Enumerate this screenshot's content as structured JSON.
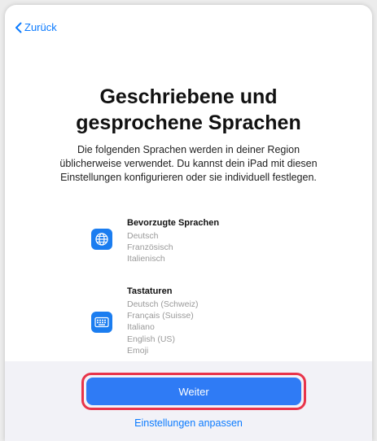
{
  "nav": {
    "back_label": "Zurück"
  },
  "title": {
    "line1": "Geschriebene und",
    "line2": "gesprochene Sprachen"
  },
  "description": {
    "line1": "Die folgenden Sprachen werden in deiner Region",
    "line2": "üblicherweise verwendet. Du kannst dein iPad mit diesen",
    "line3": "Einstellungen konfigurieren oder sie individuell festlegen."
  },
  "preferred_languages": {
    "heading": "Bevorzugte Sprachen",
    "icon": "globe-icon",
    "items": [
      "Deutsch",
      "Französisch",
      "Italienisch"
    ]
  },
  "keyboards": {
    "heading": "Tastaturen",
    "icon": "keyboard-icon",
    "items": [
      "Deutsch (Schweiz)",
      "Français (Suisse)",
      "Italiano",
      "English (US)",
      "Emoji"
    ]
  },
  "actions": {
    "continue_label": "Weiter",
    "customize_label": "Einstellungen anpassen"
  },
  "colors": {
    "accent": "#0a7aff",
    "button": "#2f7bf5",
    "highlight": "#e8344a",
    "icon_bg": "#1b7df0"
  }
}
